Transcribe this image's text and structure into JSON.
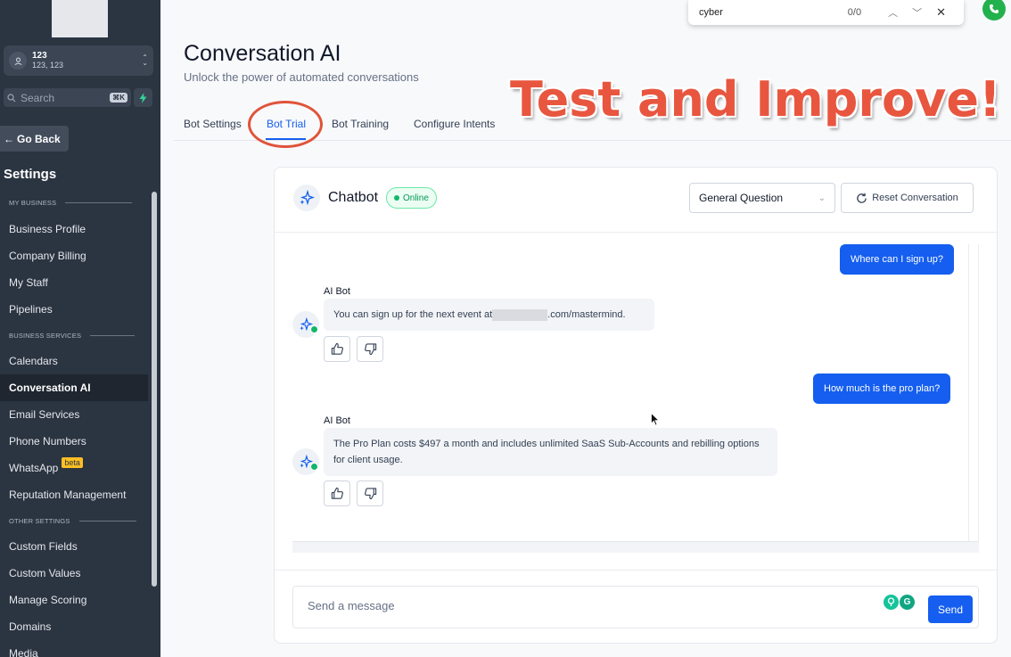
{
  "sidebar": {
    "location": {
      "name": "123",
      "address": "123, 123"
    },
    "search_placeholder": "Search",
    "search_shortcut": "⌘K",
    "go_back": "Go Back",
    "settings_title": "Settings",
    "sections": {
      "my_business": "MY BUSINESS",
      "business_services": "BUSINESS SERVICES",
      "other_settings": "OTHER SETTINGS"
    },
    "items": {
      "business_profile": "Business Profile",
      "company_billing": "Company Billing",
      "my_staff": "My Staff",
      "pipelines": "Pipelines",
      "calendars": "Calendars",
      "conversation_ai": "Conversation AI",
      "email_services": "Email Services",
      "phone_numbers": "Phone Numbers",
      "whatsapp": "WhatsApp",
      "whatsapp_badge": "beta",
      "reputation_management": "Reputation Management",
      "custom_fields": "Custom Fields",
      "custom_values": "Custom Values",
      "manage_scoring": "Manage Scoring",
      "domains": "Domains",
      "media": "Media"
    },
    "active_item": "Conversation AI"
  },
  "findbar": {
    "query": "cyber",
    "count": "0/0"
  },
  "page": {
    "title": "Conversation AI",
    "subtitle": "Unlock the power of automated conversations",
    "tabs": [
      "Bot Settings",
      "Bot Trial",
      "Bot Training",
      "Configure Intents"
    ],
    "active_tab": "Bot Trial",
    "annotation": "Test and Improve!"
  },
  "chat": {
    "title": "Chatbot",
    "status": "Online",
    "intent_select": "General Question",
    "reset_label": "Reset Conversation",
    "bot_name": "AI Bot",
    "messages": {
      "user1": "Where can I sign up?",
      "bot1_prefix": "You can sign up for the next event at",
      "bot1_suffix": ".com/mastermind.",
      "user2": "How much is the pro plan?",
      "bot2": "The Pro Plan costs $497 a month and includes unlimited SaaS Sub-Accounts and rebilling options for client usage."
    },
    "input_placeholder": "Send a message",
    "send_label": "Send"
  },
  "colors": {
    "sidebar_bg": "#2b3441",
    "primary": "#155eef",
    "annotation": "#e8563f",
    "online": "#12b76a"
  }
}
